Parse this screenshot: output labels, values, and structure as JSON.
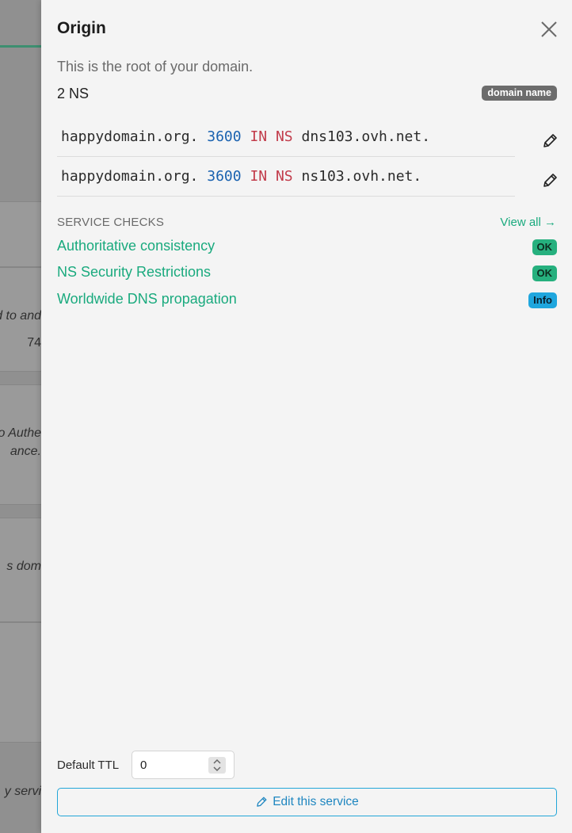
{
  "background": {
    "fragments": [
      "d to and",
      "74",
      "o Authe",
      "ance.",
      "s dom",
      "y servi"
    ]
  },
  "panel": {
    "title": "Origin",
    "description": "This is the root of your domain.",
    "ns_count": "2 NS",
    "domain_badge": "domain name",
    "records": [
      {
        "name": "happydomain.org.",
        "ttl": "3600",
        "class": "IN",
        "type": "NS",
        "value": "dns103.ovh.net."
      },
      {
        "name": "happydomain.org.",
        "ttl": "3600",
        "class": "IN",
        "type": "NS",
        "value": "ns103.ovh.net."
      }
    ],
    "checks_header": "SERVICE CHECKS",
    "view_all": "View all →",
    "checks": [
      {
        "label": "Authoritative consistency",
        "status": "OK"
      },
      {
        "label": "NS Security Restrictions",
        "status": "OK"
      },
      {
        "label": "Worldwide DNS propagation",
        "status": "Info"
      }
    ],
    "ttl_label": "Default TTL",
    "ttl_value": "0",
    "edit_service": "Edit this service"
  },
  "icons": {
    "close": "close-icon",
    "edit": "pencil-icon",
    "spinner": "chevron-up-down-icon"
  },
  "colors": {
    "accent_green": "#1aaa7e",
    "ok_badge": "#26b07e",
    "info_badge": "#1fa6de",
    "ttl_number": "#1a62b0",
    "record_keyword": "#c23b4a",
    "button_border": "#22a6d8"
  }
}
